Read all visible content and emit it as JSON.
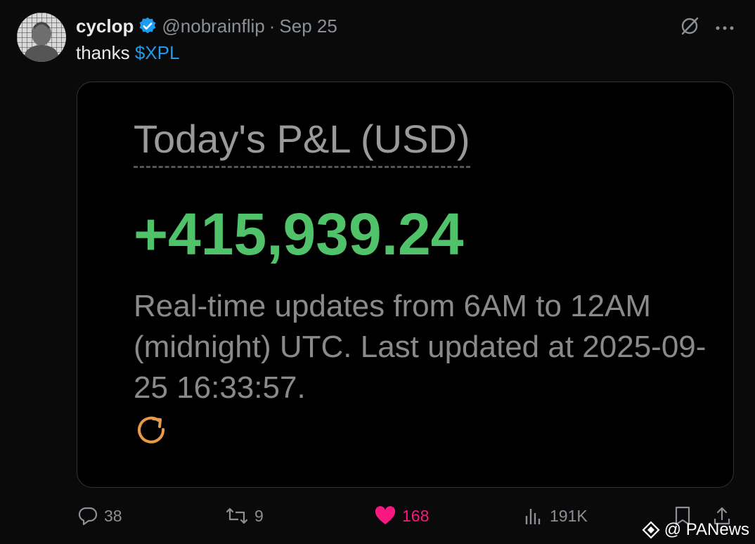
{
  "tweet": {
    "author": {
      "display_name": "cyclop",
      "handle": "@nobrainflip",
      "separator": "·",
      "date": "Sep 25",
      "verified": true
    },
    "text_prefix": "thanks ",
    "cashtag": "$XPL",
    "media": {
      "title": "Today's P&L (USD)",
      "value": "+415,939.24",
      "note": "Real-time updates from 6AM to 12AM (midnight) UTC. Last updated at 2025-09-25 16:33:57.",
      "icon": "refresh-icon"
    },
    "actions": {
      "replies": "38",
      "reposts": "9",
      "likes": "168",
      "views": "191K"
    }
  },
  "watermark": "@ PANews",
  "colors": {
    "background": "#0a0a0a",
    "cashtag": "#1d9bf0",
    "profit": "#4fc26a",
    "like": "#f91880",
    "muted": "#8b9096",
    "refresh": "#e89a4a"
  }
}
